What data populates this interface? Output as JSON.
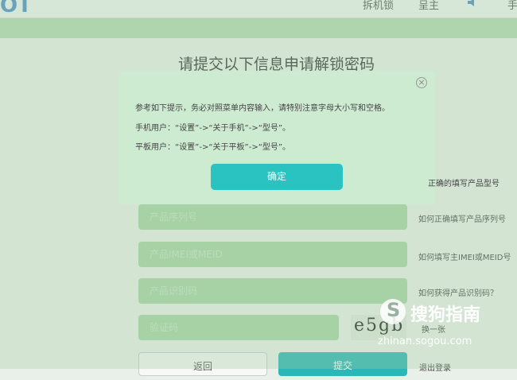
{
  "header": {
    "logo_text": "OT",
    "nav": [
      "拆机锁",
      "呈主",
      "手"
    ]
  },
  "main": {
    "heading": "请提交以下信息申请解锁密码",
    "fields": [
      {
        "placeholder": "产品序列号",
        "help": "如何正确填写产品序列号"
      },
      {
        "placeholder": "产品IMEI或MEID",
        "help": "如何填写主IMEI或MEID号"
      },
      {
        "placeholder": "产品识别码",
        "help": "如何获得产品识别码？"
      }
    ],
    "captcha_placeholder": "验证码",
    "captcha_text": "e5gb",
    "refresh_label": "换一张",
    "back_label": "返回",
    "submit_label": "提交",
    "logout_label": "退出登录",
    "model_hint": "正确的填写产品型号"
  },
  "modal": {
    "close_symbol": "×",
    "line1": "参考如下提示，务必对照菜单内容输入，请特别注意字母大小写和空格。",
    "line2": "手机用户：“设置”->“关于手机”->“型号”。",
    "line3": "平板用户：“设置”->“关于平板”->“型号”。",
    "ok_label": "确定"
  },
  "watermark": {
    "logo": "S",
    "text": "搜狗指南",
    "url": "zhinan.sogou.com"
  }
}
